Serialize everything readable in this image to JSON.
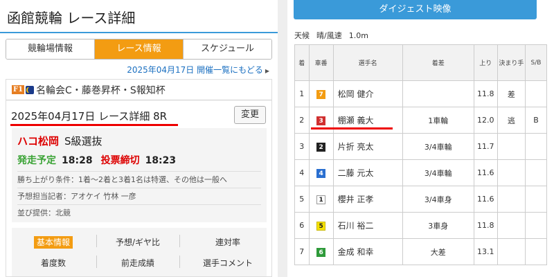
{
  "left": {
    "title": "函館競輪 レース詳細",
    "tabs": [
      {
        "label": "競輪場情報"
      },
      {
        "label": "レース情報"
      },
      {
        "label": "スケジュール"
      }
    ],
    "back_link": "2025年04月17日 開催一覧にもどる",
    "grade_badge": "F1",
    "event_name": "名輪会C・藤巻昇杯・S報知杯",
    "race_date_title": "2025年04月17日 レース詳細 8R",
    "change_button": "変更",
    "venue": "ハコ松岡",
    "race_name": "S級選抜",
    "start_label": "発走予定",
    "start_time": "18:28",
    "close_label": "投票締切",
    "close_time": "18:23",
    "conditions": "勝ち上がり条件：1着〜2着と3着1名は特選、その他は一般へ",
    "predictor": "予想担当記者：アオケイ 竹林 一彦",
    "provider": "並び提供：北競",
    "menu": {
      "basic": "基本情報",
      "prediction": "予想/ギヤ比",
      "consecutive": "連対率",
      "finish_count": "着度数",
      "prev_results": "前走成績",
      "comments": "選手コメント"
    }
  },
  "right": {
    "digest_button": "ダイジェスト映像",
    "weather_label": "天候",
    "weather_value": "晴/風速",
    "wind_speed": "1.0m",
    "headers": {
      "rank": "着",
      "car": "車番",
      "name": "選手名",
      "margin": "着差",
      "last": "上り",
      "kimarite": "決まり手",
      "sb": "S/B"
    },
    "rows": [
      {
        "rank": "1",
        "car": "7",
        "name": "松岡 健介",
        "margin": "",
        "last": "11.8",
        "kimarite": "差",
        "sb": ""
      },
      {
        "rank": "2",
        "car": "3",
        "name": "棚瀬 義大",
        "margin": "1車輪",
        "last": "12.0",
        "kimarite": "逃",
        "sb": "B"
      },
      {
        "rank": "3",
        "car": "2",
        "name": "片折 亮太",
        "margin": "3/4車輪",
        "last": "11.7",
        "kimarite": "",
        "sb": ""
      },
      {
        "rank": "4",
        "car": "4",
        "name": "二藤 元太",
        "margin": "3/4車輪",
        "last": "11.6",
        "kimarite": "",
        "sb": ""
      },
      {
        "rank": "5",
        "car": "1",
        "name": "櫻井 正孝",
        "margin": "3/4車身",
        "last": "11.6",
        "kimarite": "",
        "sb": ""
      },
      {
        "rank": "6",
        "car": "5",
        "name": "石川 裕二",
        "margin": "3車身",
        "last": "11.8",
        "kimarite": "",
        "sb": ""
      },
      {
        "rank": "7",
        "car": "6",
        "name": "金成 和幸",
        "margin": "大差",
        "last": "13.1",
        "kimarite": "",
        "sb": ""
      }
    ],
    "car_colors": {
      "1": {
        "bg": "#ffffff",
        "fg": "#222222",
        "border": "#999999"
      },
      "2": {
        "bg": "#222222",
        "fg": "#ffffff",
        "border": "#222222"
      },
      "3": {
        "bg": "#d03030",
        "fg": "#ffffff",
        "border": "#d03030"
      },
      "4": {
        "bg": "#2a6fd0",
        "fg": "#ffffff",
        "border": "#2a6fd0"
      },
      "5": {
        "bg": "#f5e100",
        "fg": "#222222",
        "border": "#c9b800"
      },
      "6": {
        "bg": "#2e9a3a",
        "fg": "#ffffff",
        "border": "#2e9a3a"
      },
      "7": {
        "bg": "#f39c12",
        "fg": "#ffffff",
        "border": "#f39c12"
      }
    }
  }
}
